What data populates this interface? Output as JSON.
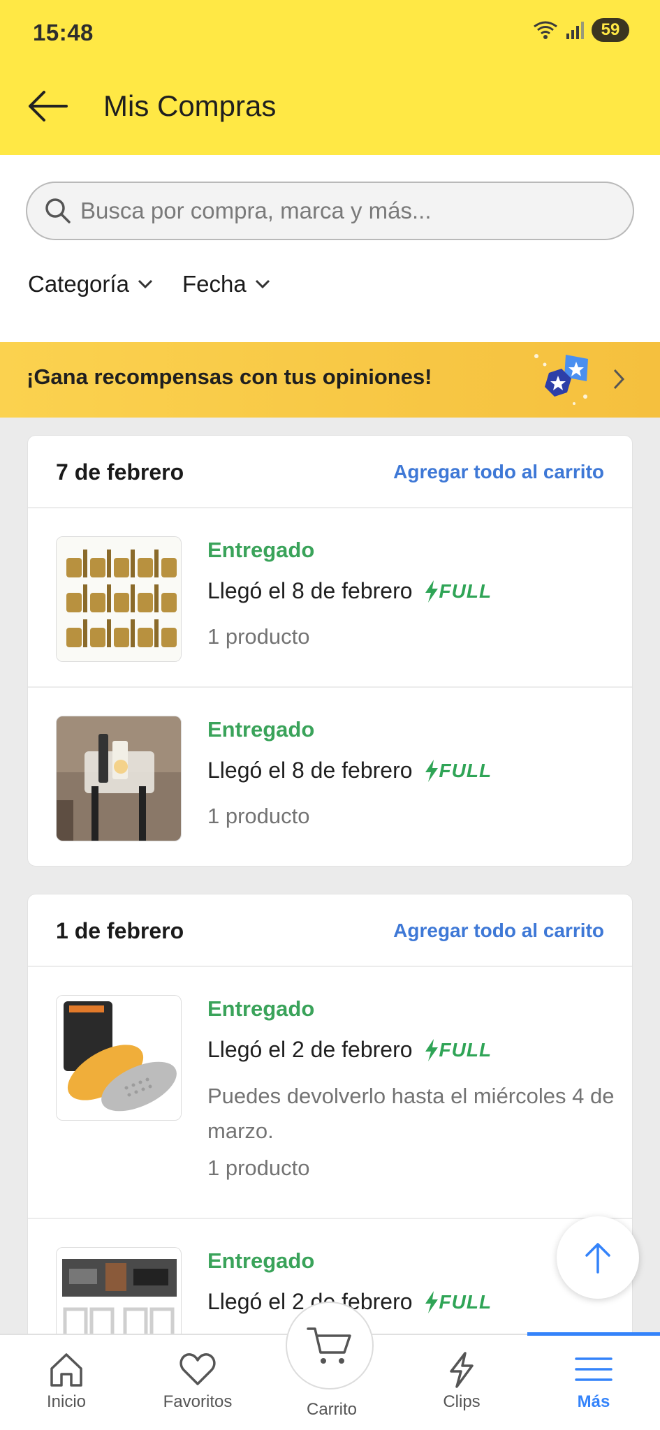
{
  "status_bar": {
    "time": "15:48",
    "battery": "59"
  },
  "header": {
    "title": "Mis Compras"
  },
  "search": {
    "placeholder": "Busca por compra, marca y más..."
  },
  "filters": {
    "category_label": "Categoría",
    "date_label": "Fecha"
  },
  "promo": {
    "text": "¡Gana recompensas con tus opiniones!"
  },
  "groups": [
    {
      "date": "7 de febrero",
      "add_all": "Agregar todo al carrito",
      "orders": [
        {
          "status": "Entregado",
          "arrived": "Llegó el 8 de febrero",
          "badge": "FULL",
          "count": "1 producto",
          "thumb": "brass-fittings"
        },
        {
          "status": "Entregado",
          "arrived": "Llegó el 8 de febrero",
          "badge": "FULL",
          "count": "1 producto",
          "thumb": "toothbrush-holder"
        }
      ]
    },
    {
      "date": "1 de febrero",
      "add_all": "Agregar todo al carrito",
      "orders": [
        {
          "status": "Entregado",
          "arrived": "Llegó el 2 de febrero",
          "badge": "FULL",
          "return_note": "Puedes devolverlo hasta el miércoles 4 de marzo.",
          "count": "1 producto",
          "thumb": "insoles"
        },
        {
          "status": "Entregado",
          "arrived": "Llegó el 2 de febrero",
          "badge": "FULL",
          "thumb": "led-clock"
        }
      ]
    }
  ],
  "bottom_nav": {
    "items": [
      {
        "label": "Inicio",
        "icon": "home-icon"
      },
      {
        "label": "Favoritos",
        "icon": "heart-icon"
      },
      {
        "label": "Carrito",
        "icon": "cart-icon"
      },
      {
        "label": "Clips",
        "icon": "lightning-icon"
      },
      {
        "label": "Más",
        "icon": "menu-icon",
        "active": true
      }
    ]
  },
  "colors": {
    "header_bg": "#ffe845",
    "accent_blue": "#3483fa",
    "status_green": "#3aa35a",
    "link_blue": "#3e78d6"
  }
}
